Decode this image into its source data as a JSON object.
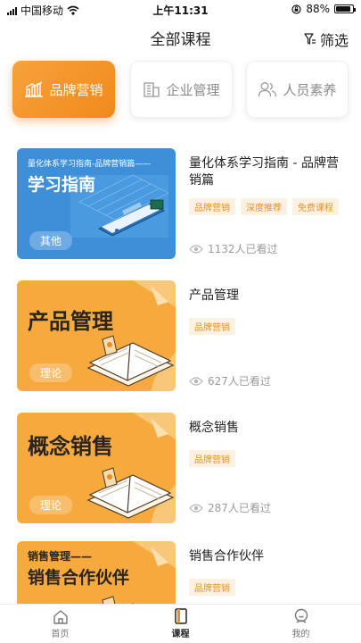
{
  "status_bar": {
    "carrier": "中国移动",
    "time": "上午11:31",
    "battery": "88%",
    "battery_level": 0.88
  },
  "nav": {
    "title": "全部课程",
    "filter_label": "筛选"
  },
  "categories": [
    {
      "label": "品牌营销",
      "icon": "bar-chart-icon",
      "active": true
    },
    {
      "label": "企业管理",
      "icon": "building-icon",
      "active": false
    },
    {
      "label": "人员素养",
      "icon": "people-icon",
      "active": false
    }
  ],
  "courses": [
    {
      "title": "量化体系学习指南 - 品牌营销篇",
      "thumb_title": "学习指南",
      "thumb_subtitle": "量化体系学习指南-品牌营销篇——",
      "thumb_tag": "其他",
      "tags": [
        "品牌营销",
        "深度推荐",
        "免费课程"
      ],
      "views": "1132人已看过",
      "theme": "blue"
    },
    {
      "title": "产品管理",
      "thumb_title": "产品管理",
      "thumb_subtitle": "",
      "thumb_tag": "理论",
      "tags": [
        "品牌营销"
      ],
      "views": "627人已看过",
      "theme": "orange"
    },
    {
      "title": "概念销售",
      "thumb_title": "概念销售",
      "thumb_subtitle": "",
      "thumb_tag": "理论",
      "tags": [
        "品牌营销"
      ],
      "views": "287人已看过",
      "theme": "orange"
    },
    {
      "title": "销售合作伙伴",
      "thumb_title": "销售合作伙伴",
      "thumb_subtitle": "销售管理——",
      "thumb_tag": "",
      "tags": [
        "品牌营销"
      ],
      "views": "",
      "theme": "orange"
    }
  ],
  "tabs": [
    {
      "label": "首页",
      "icon": "home-icon",
      "active": false
    },
    {
      "label": "课程",
      "icon": "book-icon",
      "active": true
    },
    {
      "label": "我的",
      "icon": "profile-icon",
      "active": false
    }
  ],
  "colors": {
    "accent": "#f08a1d",
    "tag_bg": "#fdf1e2",
    "tag_text": "#e09238",
    "blue_thumb": "#3f8fd8",
    "orange_thumb": "#f6a93c"
  }
}
